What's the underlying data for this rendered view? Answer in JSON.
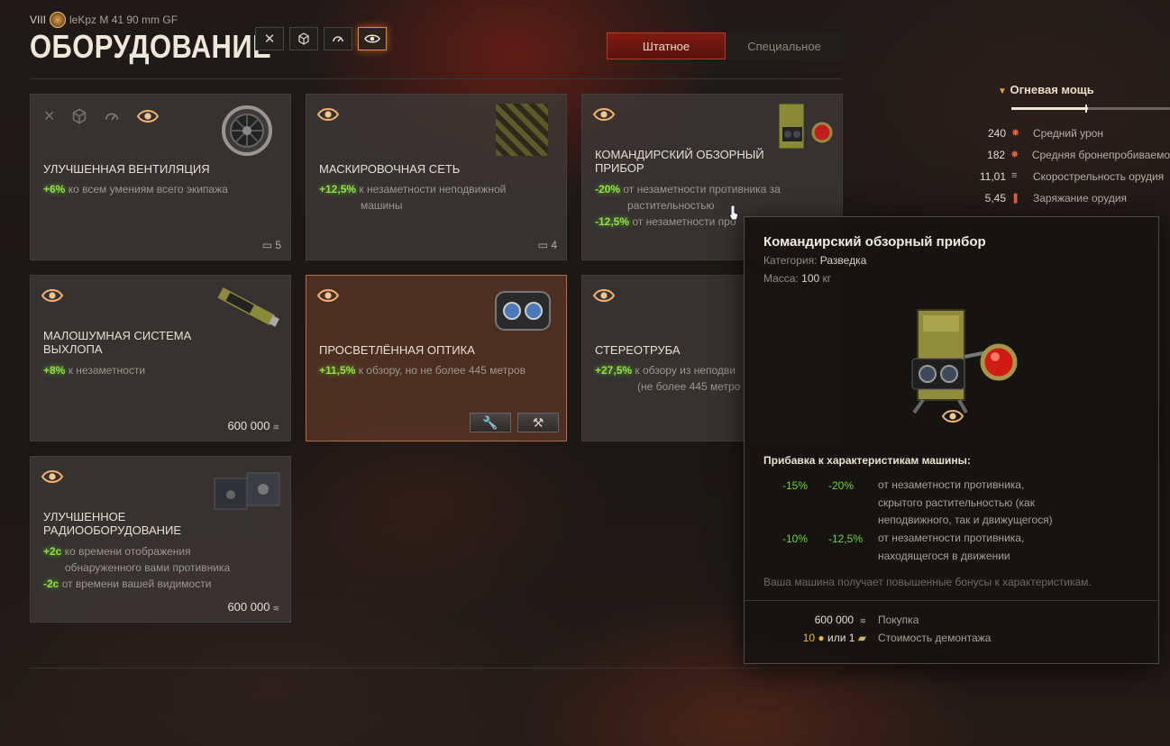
{
  "header": {
    "tier": "VIII",
    "vehicle": "leKpz M 41 90 mm GF",
    "title": "ОБОРУДОВАНИЕ",
    "filters": [
      {
        "icon": "crossed-arrows-icon",
        "active": false
      },
      {
        "icon": "cube-icon",
        "active": false
      },
      {
        "icon": "gauge-icon",
        "active": false
      },
      {
        "icon": "eye-icon",
        "active": true
      }
    ]
  },
  "tabs": [
    {
      "label": "Штатное",
      "active": true
    },
    {
      "label": "Специальное",
      "active": false
    }
  ],
  "cards": [
    {
      "name": "УЛУЧШЕННАЯ ВЕНТИЛЯЦИЯ",
      "bonus1": "+6%",
      "text1": "ко всем умениям всего экипажа",
      "count": "5"
    },
    {
      "name": "МАСКИРОВОЧНАЯ СЕТЬ",
      "bonus1": "+12,5%",
      "text1": "к незаметности неподвижной",
      "text1b": "машины",
      "count": "4"
    },
    {
      "name": "КОМАНДИРСКИЙ ОБЗОРНЫЙ",
      "name2": "ПРИБОР",
      "bonus1": "-20%",
      "text1": "от незаметности противника за",
      "text1b": "растительностью",
      "bonus2": "-12,5%",
      "text2": "от незаметности про"
    },
    {
      "name": "МАЛОШУМНАЯ СИСТЕМА",
      "name2": "ВЫХЛОПА",
      "bonus1": "+8%",
      "text1": "к незаметности",
      "price": "600 000"
    },
    {
      "name": "ПРОСВЕТЛЁННАЯ ОПТИКА",
      "bonus1": "+11,5%",
      "text1": "к обзору, но не более 445 метров"
    },
    {
      "name": "СТЕРЕОТРУБА",
      "bonus1": "+27,5%",
      "text1": "к обзору из неподви",
      "text1b": "(не более 445 метро"
    },
    {
      "name": "УЛУЧШЕННОЕ",
      "name2": "РАДИООБОРУДОВАНИЕ",
      "bonus1": "+2с",
      "text1": "ко времени отображения",
      "text1b": "обнаруженного вами противника",
      "bonus2": "-2с",
      "text2": "от времени вашей видимости",
      "price": "600 000"
    }
  ],
  "stats": {
    "section": "Огневая мощь",
    "rows": [
      {
        "value": "240",
        "label": "Средний урон"
      },
      {
        "value": "182",
        "label": "Средняя бронепробиваемо"
      },
      {
        "value": "11,01",
        "label": "Скорострельность орудия"
      },
      {
        "value": "5,45",
        "label": "Заряжание орудия"
      }
    ]
  },
  "tooltip": {
    "title": "Командирский обзорный прибор",
    "cat_label": "Категория:",
    "cat_value": "Разведка",
    "mass_label": "Масса:",
    "mass_value": "100",
    "mass_unit": "кг",
    "subtitle": "Прибавка к характеристикам машины:",
    "rows": [
      {
        "a": "-15%",
        "b": "-20%",
        "l1": "от незаметности противника,",
        "l2": "скрытого растительностью (как",
        "l3": "неподвижного, так и движущегося)"
      },
      {
        "a": "-10%",
        "b": "-12,5%",
        "l1": "от незаметности противника,",
        "l2": "находящегося в движении"
      }
    ],
    "note": "Ваша машина получает повышенные бонусы к характеристикам.",
    "buy_price": "600 000",
    "buy_label": "Покупка",
    "dem_gold": "10",
    "dem_or": "или 1",
    "dem_label": "Стоимость демонтажа"
  }
}
